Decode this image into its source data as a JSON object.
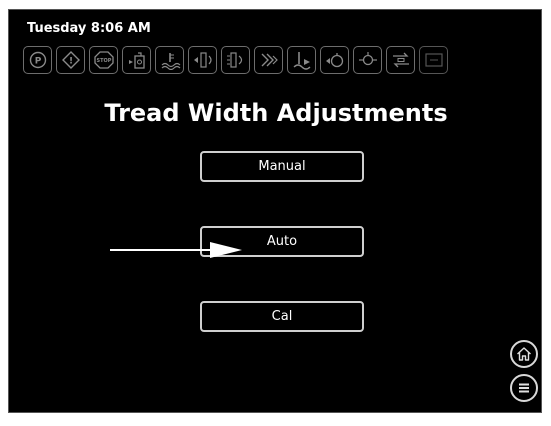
{
  "header": {
    "datetime": "Tuesday 8:06 AM"
  },
  "indicators": [
    {
      "icon": "parking-brake-icon",
      "label": "P"
    },
    {
      "icon": "warning-icon",
      "label": "!"
    },
    {
      "icon": "stop-icon",
      "label": "STOP"
    },
    {
      "icon": "fuel-icon"
    },
    {
      "icon": "coolant-temp-icon"
    },
    {
      "icon": "tread-left-icon"
    },
    {
      "icon": "tread-right-icon"
    },
    {
      "icon": "steering-icon"
    },
    {
      "icon": "hydraulic-icon"
    },
    {
      "icon": "pump-icon"
    },
    {
      "icon": "filter-icon"
    },
    {
      "icon": "transmission-icon"
    },
    {
      "icon": "battery-icon"
    }
  ],
  "main": {
    "title": "Tread Width Adjustments",
    "buttons": {
      "manual": "Manual",
      "auto": "Auto",
      "cal": "Cal"
    }
  },
  "colors": {
    "screen_bg": "#000000",
    "icon_outline": "#6d6d6d",
    "text": "#ffffff"
  }
}
